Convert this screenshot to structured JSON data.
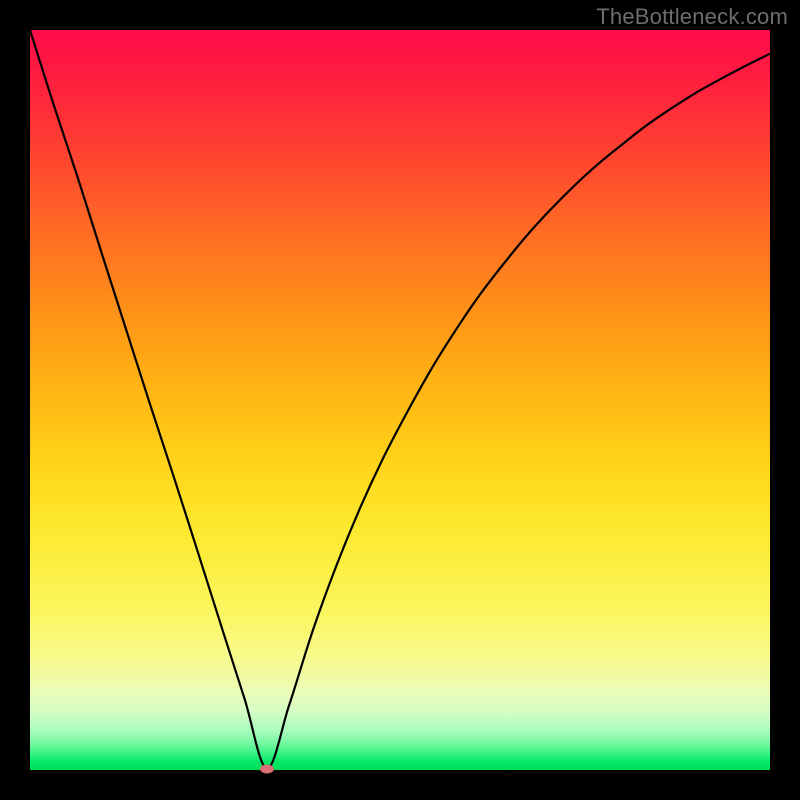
{
  "watermark": "TheBottleneck.com",
  "colors": {
    "curve_stroke": "#000000",
    "marker_fill": "#d87076",
    "frame_bg": "#000000"
  },
  "chart_data": {
    "type": "line",
    "title": "",
    "xlabel": "",
    "ylabel": "",
    "xlim": [
      0,
      1
    ],
    "ylim": [
      0,
      1
    ],
    "note": "No axes, ticks, legend, or labels are rendered in the image. x and y are normalized to the plot-area; y=0 is at the bottom (green) and y=1 at the top (red). The single black curve descends steeply from the top-left to a minimum near x≈0.32 and rises with decreasing slope toward the right.",
    "series": [
      {
        "name": "bottleneck-curve",
        "x": [
          0.0,
          0.032,
          0.065,
          0.097,
          0.129,
          0.161,
          0.194,
          0.226,
          0.258,
          0.29,
          0.32,
          0.35,
          0.382,
          0.414,
          0.446,
          0.478,
          0.511,
          0.543,
          0.575,
          0.607,
          0.64,
          0.672,
          0.704,
          0.736,
          0.769,
          0.801,
          0.833,
          0.865,
          0.898,
          0.93,
          0.962,
          1.0
        ],
        "y": [
          1.0,
          0.899,
          0.799,
          0.698,
          0.598,
          0.498,
          0.397,
          0.297,
          0.196,
          0.096,
          0.002,
          0.087,
          0.188,
          0.276,
          0.354,
          0.423,
          0.486,
          0.543,
          0.594,
          0.641,
          0.684,
          0.723,
          0.758,
          0.79,
          0.82,
          0.846,
          0.871,
          0.893,
          0.914,
          0.932,
          0.949,
          0.968
        ]
      }
    ],
    "minimum_point": {
      "x": 0.32,
      "y": 0.002
    }
  }
}
